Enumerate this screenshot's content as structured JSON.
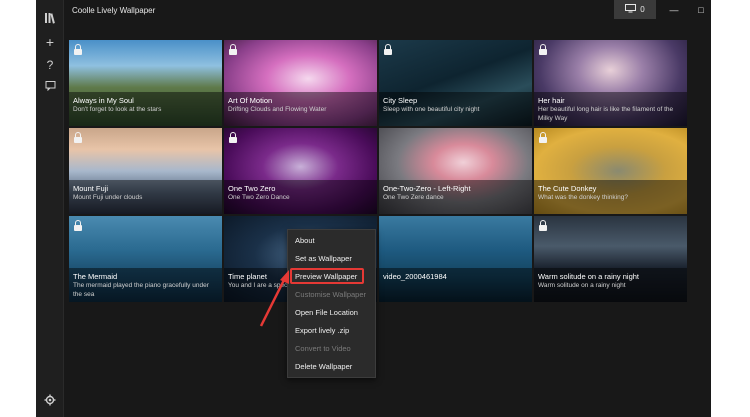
{
  "app": {
    "title": "Coolle Lively Wallpaper",
    "screen_count": "0"
  },
  "sidebar": {
    "icons": [
      "library-icon",
      "add-icon",
      "help-icon",
      "feedback-icon",
      "settings-icon"
    ]
  },
  "tiles": [
    {
      "title": "Always in My Soul",
      "desc": "Don't forget to look at the stars",
      "locked": true
    },
    {
      "title": "Art Of Motion",
      "desc": "Drifting Clouds and Flowing Water",
      "locked": true
    },
    {
      "title": "City Sleep",
      "desc": "Sleep with one beautiful city night",
      "locked": true
    },
    {
      "title": "Her hair",
      "desc": "Her beautiful long hair is like the filament of the Milky Way",
      "locked": true
    },
    {
      "title": "Mount Fuji",
      "desc": "Mount Fuji under clouds",
      "locked": true
    },
    {
      "title": "One Two Zero",
      "desc": "One Two Zero Dance",
      "locked": true
    },
    {
      "title": "One-Two-Zero - Left-Right",
      "desc": "One Two Zere dance",
      "locked": true
    },
    {
      "title": "The Cute Donkey",
      "desc": "What was the donkey thinking?",
      "locked": true
    },
    {
      "title": "The Mermaid",
      "desc": "The mermaid played the piano gracefully under the sea",
      "locked": true
    },
    {
      "title": "Time planet",
      "desc": "You and I are a spec",
      "locked": false
    },
    {
      "title": "video_2000461984",
      "desc": "",
      "locked": false
    },
    {
      "title": "Warm solitude on a rainy night",
      "desc": "Warm solitude on a rainy night",
      "locked": true
    }
  ],
  "context_menu": {
    "items": [
      {
        "label": "About",
        "disabled": false
      },
      {
        "label": "Set as Wallpaper",
        "disabled": false
      },
      {
        "label": "Preview Wallpaper",
        "disabled": false,
        "highlighted": true
      },
      {
        "label": "Customise Wallpaper",
        "disabled": true
      },
      {
        "label": "Open File Location",
        "disabled": false
      },
      {
        "label": "Export lively .zip",
        "disabled": false
      },
      {
        "label": "Convert to Video",
        "disabled": true
      },
      {
        "label": "Delete Wallpaper",
        "disabled": false
      }
    ]
  },
  "colors": {
    "highlight": "#e53935",
    "background": "#181818"
  }
}
